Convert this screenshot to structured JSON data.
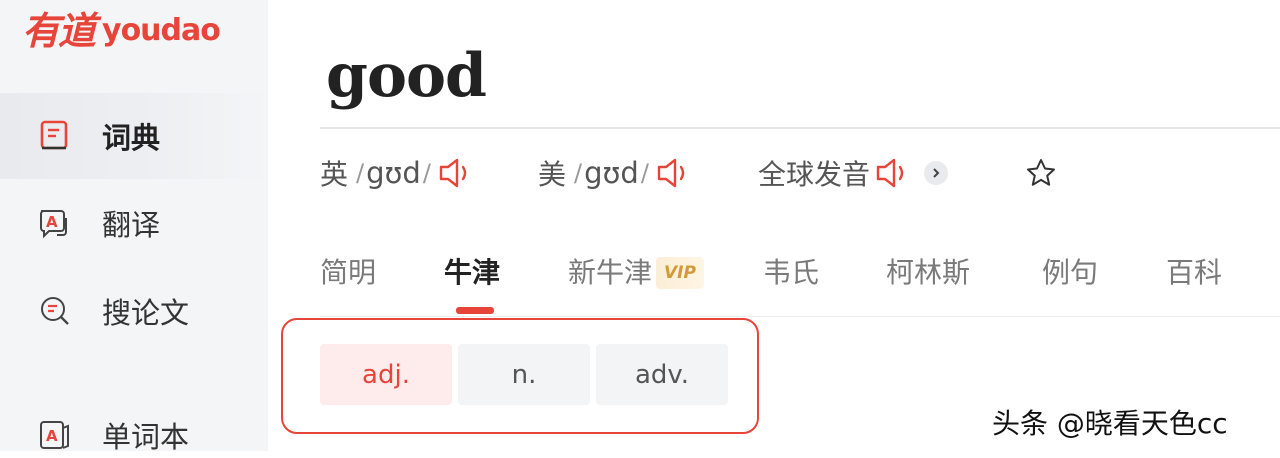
{
  "logo": {
    "cn": "有道",
    "en": "youdao"
  },
  "sidebar": {
    "items": [
      {
        "label": "词典",
        "icon": "dictionary-icon",
        "active": true
      },
      {
        "label": "翻译",
        "icon": "translate-icon",
        "active": false
      },
      {
        "label": "搜论文",
        "icon": "paper-search-icon",
        "active": false
      },
      {
        "label": "单词本",
        "icon": "wordbook-icon",
        "active": false
      }
    ]
  },
  "entry": {
    "word": "good",
    "pronunciations": [
      {
        "region": "英",
        "ipa": "gʊd",
        "slash": "/"
      },
      {
        "region": "美",
        "ipa": "gʊd",
        "slash": "/"
      }
    ],
    "global_pron_label": "全球发音"
  },
  "tabs": [
    {
      "label": "简明"
    },
    {
      "label": "牛津",
      "active": true
    },
    {
      "label": "新牛津",
      "badge": "VIP"
    },
    {
      "label": "韦氏"
    },
    {
      "label": "柯林斯"
    },
    {
      "label": "例句"
    },
    {
      "label": "百科"
    }
  ],
  "pos_tabs": [
    {
      "label": "adj.",
      "active": true
    },
    {
      "label": "n.",
      "active": false
    },
    {
      "label": "adv.",
      "active": false
    }
  ],
  "watermark": "头条 @晓看天色cc",
  "colors": {
    "accent": "#e8453a",
    "sidebar_bg": "#f4f5f7",
    "vip_gold": "#d39a3a"
  }
}
